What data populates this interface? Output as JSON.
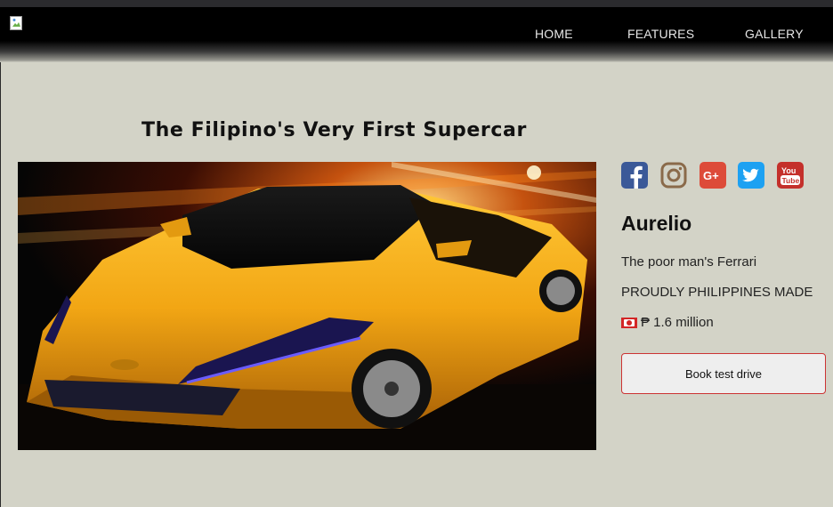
{
  "nav": {
    "links": [
      "HOME",
      "FEATURES",
      "GALLERY"
    ]
  },
  "hero": {
    "headline": "The Filipino's Very First Supercar"
  },
  "social": {
    "icons": [
      "facebook-icon",
      "instagram-icon",
      "google-plus-icon",
      "twitter-icon",
      "youtube-icon"
    ],
    "colors": {
      "facebook": "#3b5998",
      "instagram": "#8a6a4a",
      "google_plus": "#dd4b39",
      "twitter": "#1da1f2",
      "youtube": "#c4302b"
    }
  },
  "product": {
    "name": "Aurelio",
    "tagline": "The poor man's Ferrari",
    "made_in": "PROUDLY PHILIPPINES MADE",
    "price": "₱ 1.6 million",
    "cta_label": "Book test drive"
  },
  "colors": {
    "navbar_bg": "#000000",
    "page_bg": "#d3d3c7",
    "button_border": "#cc3333",
    "car_yellow": "#f2a614"
  }
}
